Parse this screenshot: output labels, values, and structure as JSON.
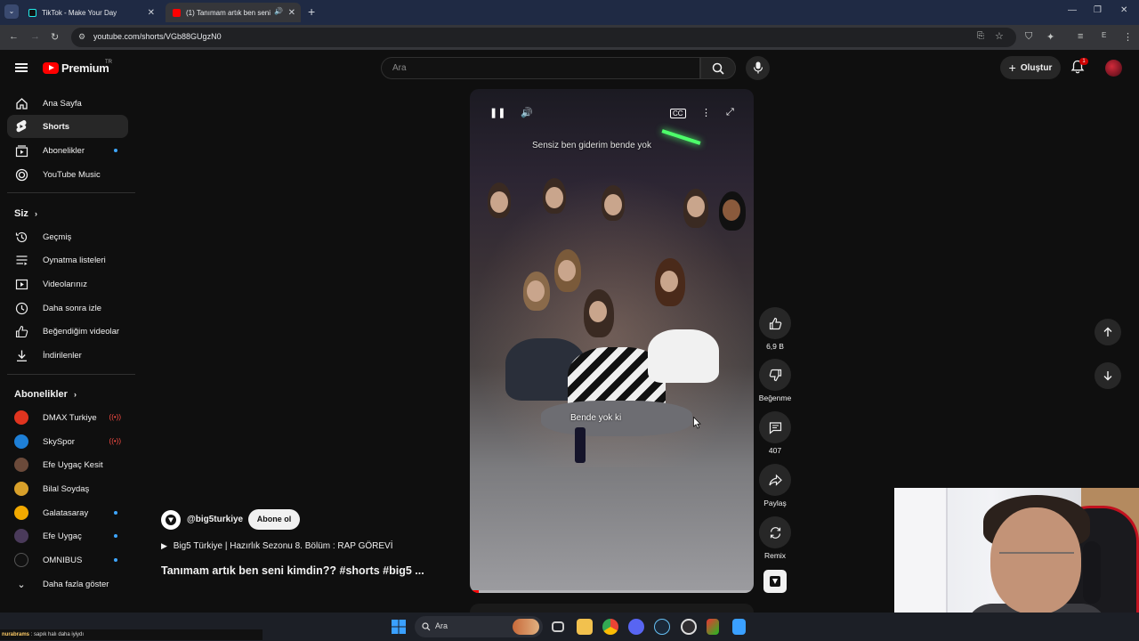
{
  "browser": {
    "tabs": [
      {
        "title": "TikTok - Make Your Day",
        "active": false
      },
      {
        "title": "(1) Tanımam artık ben seni",
        "active": true
      }
    ],
    "url": "youtube.com/shorts/VGb88GUgzN0",
    "profile_letter": "E"
  },
  "header": {
    "logo_text": "Premium",
    "country_code": "TR",
    "search_placeholder": "Ara",
    "create_label": "Oluştur",
    "notification_count": "1"
  },
  "sidebar": {
    "main": [
      {
        "label": "Ana Sayfa",
        "icon": "home-icon"
      },
      {
        "label": "Shorts",
        "icon": "shorts-icon",
        "active": true
      },
      {
        "label": "Abonelikler",
        "icon": "subscriptions-icon",
        "dot": true
      },
      {
        "label": "YouTube Music",
        "icon": "music-icon"
      }
    ],
    "you_heading": "Siz",
    "you": [
      {
        "label": "Geçmiş",
        "icon": "history-icon"
      },
      {
        "label": "Oynatma listeleri",
        "icon": "playlist-icon"
      },
      {
        "label": "Videolarınız",
        "icon": "your-videos-icon"
      },
      {
        "label": "Daha sonra izle",
        "icon": "watch-later-icon"
      },
      {
        "label": "Beğendiğim videolar",
        "icon": "liked-icon"
      },
      {
        "label": "İndirilenler",
        "icon": "download-icon"
      }
    ],
    "subs_heading": "Abonelikler",
    "subscriptions": [
      {
        "label": "DMAX Turkiye",
        "color": "#e0341f",
        "status": "live"
      },
      {
        "label": "SkySpor",
        "color": "#1e7fd6",
        "status": "live"
      },
      {
        "label": "Efe Uygaç Kesit",
        "color": "#6b4a3a",
        "status": ""
      },
      {
        "label": "Bilal Soydaş",
        "color": "#d8a02a",
        "status": ""
      },
      {
        "label": "Galatasaray",
        "color": "#f2a900",
        "status": "dot"
      },
      {
        "label": "Efe Uygaç",
        "color": "#4a3a5a",
        "status": "dot"
      },
      {
        "label": "OMNIBUS",
        "color": "#111111",
        "status": "dot"
      }
    ],
    "show_more": "Daha fazla göster"
  },
  "player": {
    "caption_top": "Sensiz ben giderim bende yok",
    "caption_bottom": "Bende yok ki",
    "progress": 0.03
  },
  "actions": {
    "likes": "6,9 B",
    "dislike_label": "Beğenme",
    "comments": "407",
    "share_label": "Paylaş",
    "remix_label": "Remix"
  },
  "meta": {
    "channel": "@big5turkiye",
    "subscribe_label": "Abone ol",
    "playlist": "Big5 Türkiye | Hazırlık Sezonu 8. Bölüm : RAP GÖREVİ",
    "title": "Tanımam artık ben seni kimdin?? #shorts #big5 ..."
  },
  "taskbar": {
    "search_placeholder": "Ara"
  },
  "chat": {
    "user": "nurabrams",
    "message": ": sapık halı daha iyiydı"
  }
}
